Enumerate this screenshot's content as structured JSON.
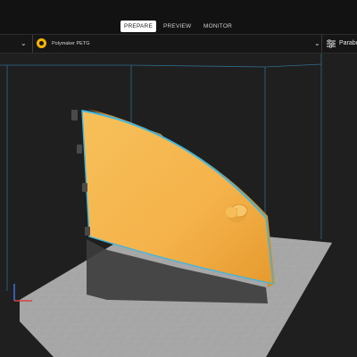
{
  "tabs": [
    {
      "label": "PREPARE",
      "active": true
    },
    {
      "label": "PREVIEW",
      "active": false
    },
    {
      "label": "MONITOR",
      "active": false
    }
  ],
  "toolbar": {
    "material": "Polymaker PETG",
    "profile": "Parabola"
  },
  "icons": {
    "material": "filament-spool-icon",
    "settings": "sliders-icon",
    "chevron_left": "chevron-down-icon",
    "chevron_right": "chevron-down-icon"
  },
  "colors": {
    "model": "#f5b64c",
    "model_outline": "#3fb6e0",
    "bed": "#a9a9a9",
    "build_volume": "#2f6f90",
    "background": "#202020"
  }
}
